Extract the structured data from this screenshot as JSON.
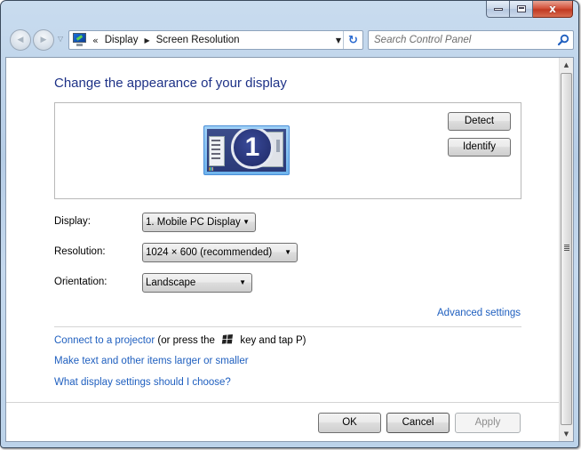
{
  "window": {
    "caption_buttons": {
      "minimize_icon": "minimize-icon",
      "maximize_icon": "maximize-icon",
      "close_icon": "close-icon",
      "close_glyph": "x"
    }
  },
  "navbar": {
    "back_glyph": "◀",
    "forward_glyph": "▶",
    "history_glyph": "▽",
    "address": {
      "overflow_glyph": "«",
      "breadcrumbs": [
        "Display",
        "Screen Resolution"
      ],
      "separator_glyph": "▶",
      "dropdown_glyph": "▼",
      "refresh_glyph": "↻"
    },
    "search": {
      "placeholder": "Search Control Panel"
    }
  },
  "main": {
    "title": "Change the appearance of your display",
    "monitor_preview": {
      "monitor_number": "1",
      "detect_label": "Detect",
      "identify_label": "Identify"
    },
    "form": {
      "display": {
        "label": "Display:",
        "value": "1. Mobile PC Display"
      },
      "resolution": {
        "label": "Resolution:",
        "value": "1024 × 600 (recommended)"
      },
      "orientation": {
        "label": "Orientation:",
        "value": "Landscape"
      }
    },
    "advanced_settings_link": "Advanced settings",
    "links": {
      "projector_link": "Connect to a projector",
      "projector_hint_pre": "(or press the",
      "projector_hint_post": "key and tap P)",
      "larger_text": "Make text and other items larger or smaller",
      "choose_settings": "What display settings should I choose?"
    },
    "buttons": {
      "ok": "OK",
      "cancel": "Cancel",
      "apply": "Apply"
    }
  },
  "colors": {
    "title": "#1e3287",
    "link": "#1f5fbf",
    "close_button": "#c13a22"
  }
}
